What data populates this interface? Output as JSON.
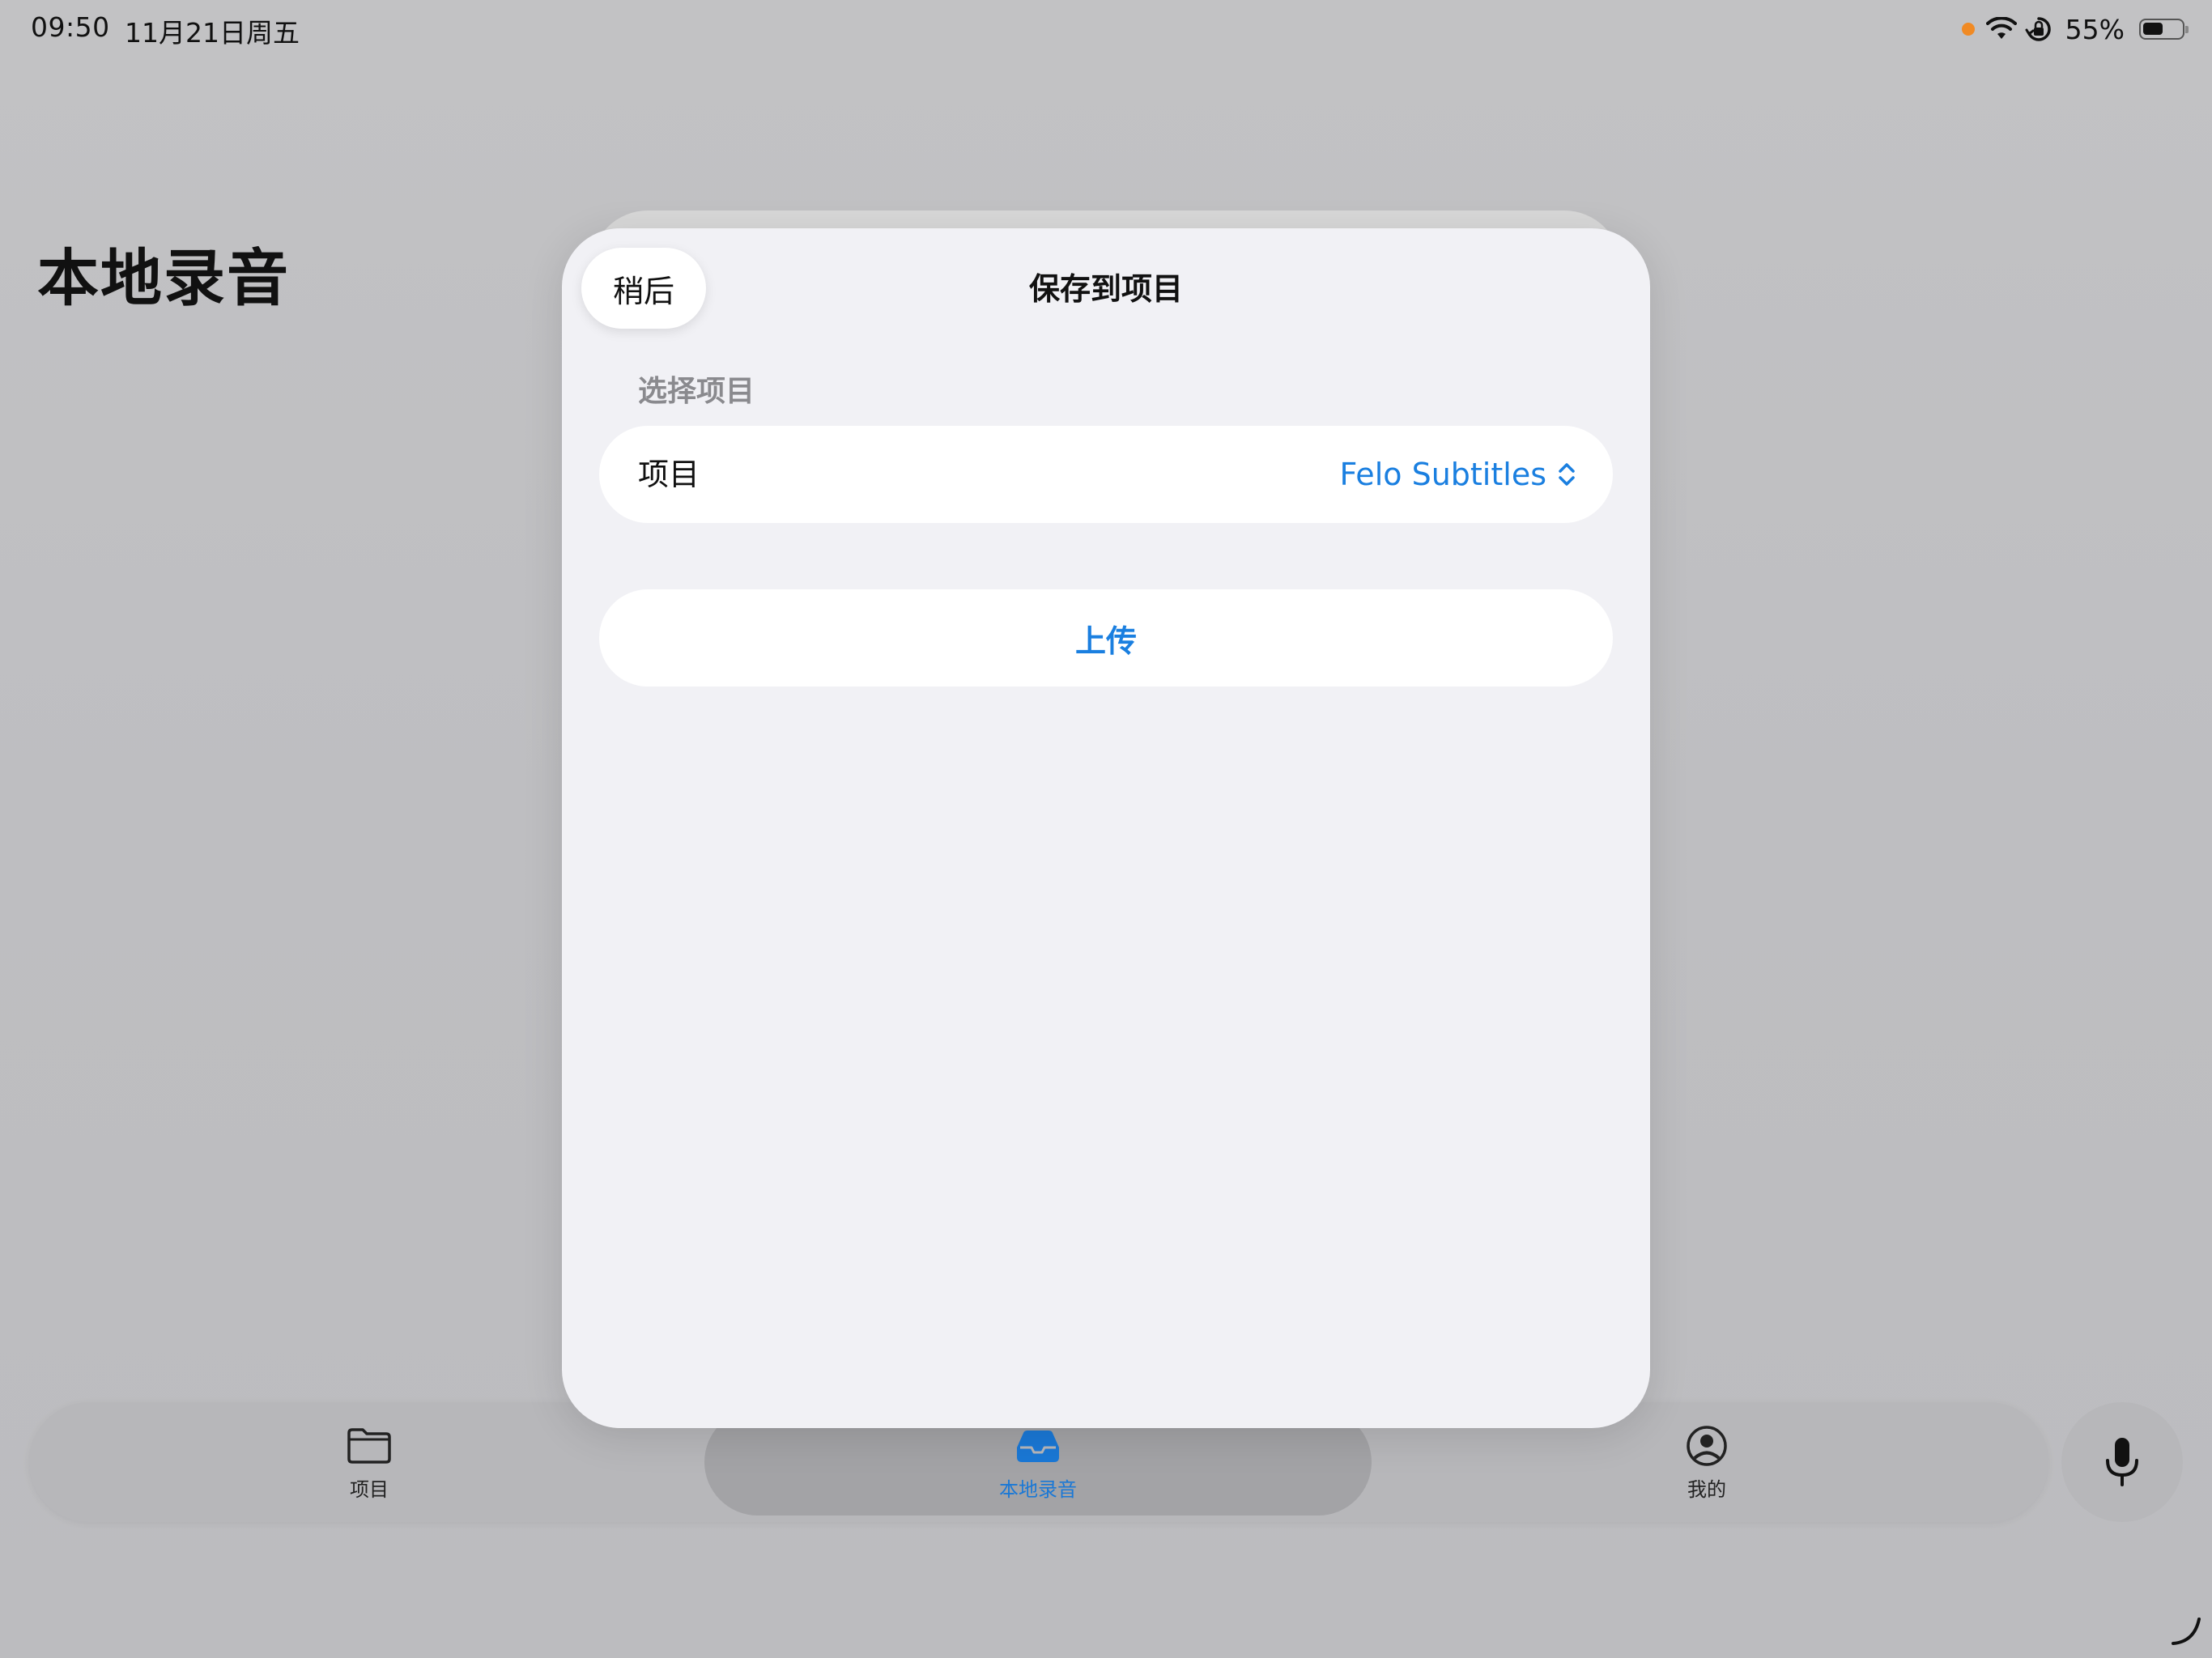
{
  "status_bar": {
    "time": "09:50",
    "date": "11月21日周五",
    "battery_percent_text": "55%",
    "battery_level": 0.55,
    "icons": [
      "recording-dot",
      "wifi-icon",
      "orientation-lock-icon",
      "battery-icon"
    ]
  },
  "page": {
    "title": "本地录音"
  },
  "sheet": {
    "later_label": "稍后",
    "title": "保存到项目",
    "section_label": "选择项目",
    "project_row_label": "项目",
    "project_value": "Felo Subtitles",
    "upload_label": "上传"
  },
  "tab_bar": {
    "tabs": [
      {
        "label": "项目",
        "icon": "folder-icon",
        "selected": false
      },
      {
        "label": "本地录音",
        "icon": "tray-icon",
        "selected": true
      },
      {
        "label": "我的",
        "icon": "person-circle-icon",
        "selected": false
      }
    ],
    "mic_icon": "microphone-icon"
  },
  "colors": {
    "accent": "#1a7fe0",
    "background": "#bebec1",
    "sheet": "#f1f1f5",
    "recording_dot": "#f08a24"
  }
}
